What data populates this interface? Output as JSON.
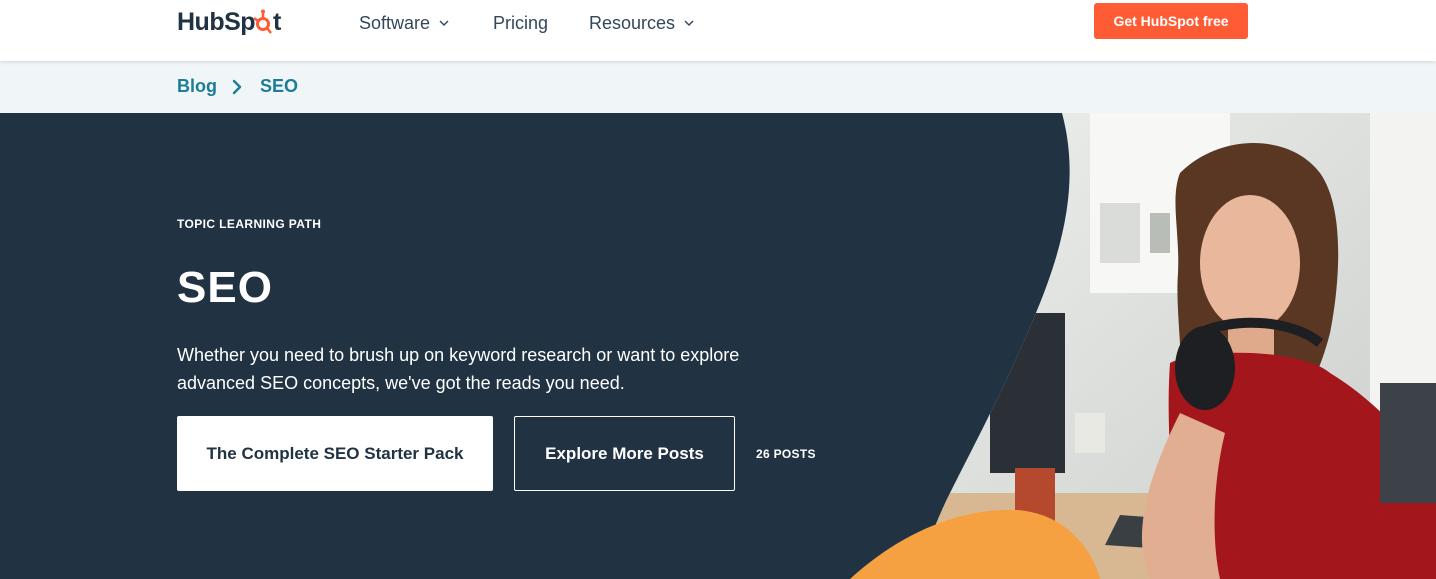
{
  "nav": {
    "logo": {
      "text_before": "HubSp",
      "text_after": "t"
    },
    "items": [
      {
        "label": "Software",
        "has_dropdown": true
      },
      {
        "label": "Pricing",
        "has_dropdown": false
      },
      {
        "label": "Resources",
        "has_dropdown": true
      }
    ],
    "cta_label": "Get HubSpot free"
  },
  "breadcrumb": {
    "items": [
      {
        "label": "Blog"
      },
      {
        "label": "SEO"
      }
    ],
    "separator_icon": "chevron-right-icon"
  },
  "hero": {
    "eyebrow": "TOPIC LEARNING PATH",
    "title": "SEO",
    "description": "Whether you need to brush up on keyword research or want to explore advanced SEO concepts, we've got the reads you need.",
    "primary_button": "The Complete SEO Starter Pack",
    "secondary_button": "Explore More Posts",
    "post_count": "26 POSTS"
  },
  "colors": {
    "brand_orange": "#ff5c35",
    "hero_bg": "#213343",
    "breadcrumb_bg": "#f0f5f8",
    "breadcrumb_text": "#1d7d96",
    "accent_blob": "#f5a142"
  }
}
